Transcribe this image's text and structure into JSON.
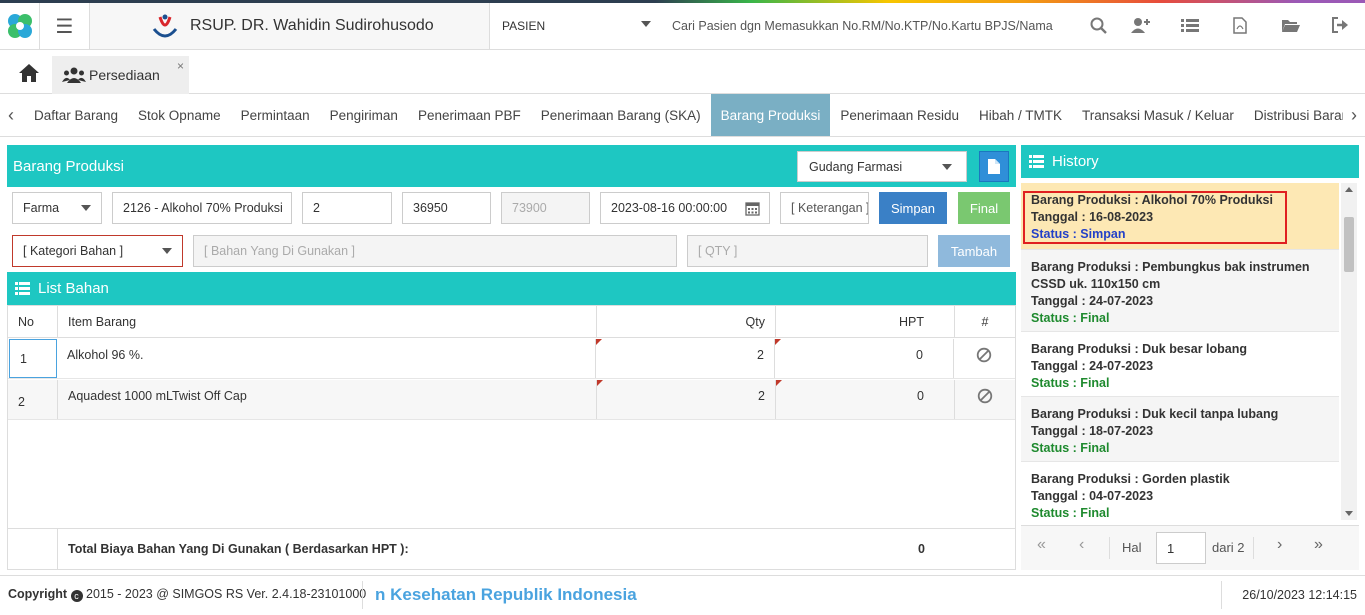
{
  "app": {
    "hospital_name": "RSUP. DR. Wahidin Sudirohusodo",
    "patient_selector": "PASIEN",
    "search_placeholder": "Cari Pasien dgn Memasukkan No.RM/No.KTP/No.Kartu BPJS/Nama"
  },
  "tabs": {
    "module_tab": "Persediaan",
    "close": "×"
  },
  "subnav": {
    "items": [
      "Daftar Barang",
      "Stok Opname",
      "Permintaan",
      "Pengiriman",
      "Penerimaan PBF",
      "Penerimaan Barang (SKA)",
      "Barang Produksi",
      "Penerimaan Residu",
      "Hibah / TMTK",
      "Transaksi Masuk / Keluar",
      "Distribusi Barang"
    ],
    "active": "Barang Produksi"
  },
  "form": {
    "title": "Barang Produksi",
    "warehouse": "Gudang Farmasi",
    "category": "Farma",
    "item": "2126 - Alkohol 70% Produksi",
    "qty": "2",
    "price": "36950",
    "total": "73900",
    "datetime": "2023-08-16 00:00:00",
    "note_placeholder": "[ Keterangan ]",
    "save_label": "Simpan",
    "final_label": "Final",
    "material_category_placeholder": "[ Kategori Bahan ]",
    "material_placeholder": "[ Bahan Yang Di Gunakan ]",
    "material_qty_placeholder": "[ QTY ]",
    "add_label": "Tambah"
  },
  "list": {
    "title": "List Bahan",
    "columns": [
      "No",
      "Item Barang",
      "Qty",
      "HPT",
      "#"
    ],
    "rows": [
      {
        "no": "1",
        "item": "Alkohol 96 %.",
        "qty": "2",
        "hpt": "0"
      },
      {
        "no": "2",
        "item": "Aquadest 1000 mLTwist Off Cap",
        "qty": "2",
        "hpt": "0"
      }
    ],
    "total_label": "Total Biaya Bahan Yang Di Gunakan ( Berdasarkan HPT ):",
    "total_value": "0"
  },
  "history": {
    "title": "History",
    "items": [
      {
        "name": "Barang Produksi : Alkohol 70% Produksi",
        "date": "Tanggal : 16-08-2023",
        "status": "Status : Simpan"
      },
      {
        "name": "Barang Produksi : Pembungkus bak instrumen CSSD uk. 110x150 cm",
        "date": "Tanggal : 24-07-2023",
        "status": "Status : Final"
      },
      {
        "name": "Barang Produksi : Duk besar lobang",
        "date": "Tanggal : 24-07-2023",
        "status": "Status : Final"
      },
      {
        "name": "Barang Produksi : Duk kecil tanpa lubang",
        "date": "Tanggal : 18-07-2023",
        "status": "Status : Final"
      },
      {
        "name": "Barang Produksi : Gorden plastik",
        "date": "Tanggal : 04-07-2023",
        "status": "Status : Final"
      }
    ],
    "pager": {
      "label": "Hal",
      "page": "1",
      "of": "dari 2"
    }
  },
  "footer": {
    "copyright_label": "Copyright",
    "copyright_text": "2015 - 2023 @ SIMGOS RS Ver. 2.4.18-23101000",
    "marquee": "n Kesehatan Republik Indonesia",
    "datetime": "26/10/2023 12:14:15"
  },
  "colors": {
    "accent": "#1ec7c2",
    "active_tab": "#7aafc4",
    "save": "#3a80c6",
    "final": "#7ac870",
    "add": "#8fb9dc"
  }
}
